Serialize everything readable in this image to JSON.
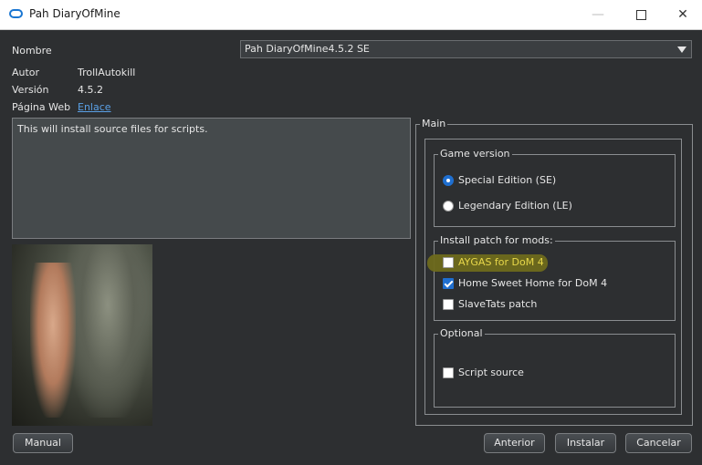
{
  "window": {
    "title": "Pah DiaryOfMine"
  },
  "fields": {
    "nombre_label": "Nombre",
    "autor_label": "Autor",
    "autor_value": "TrollAutokill",
    "version_label": "Versión",
    "version_value": "4.5.2",
    "web_label": "Página Web",
    "web_link": "Enlace"
  },
  "combo": {
    "selected": "Pah DiaryOfMine4.5.2 SE"
  },
  "description": "This will install source files for scripts.",
  "main": {
    "title": "Main",
    "game_version": {
      "title": "Game version",
      "options": [
        {
          "label": "Special Edition (SE)",
          "selected": true
        },
        {
          "label": "Legendary Edition (LE)",
          "selected": false
        }
      ]
    },
    "patches": {
      "title": "Install patch for mods:",
      "options": [
        {
          "label": "AYGAS for DoM 4",
          "checked": false
        },
        {
          "label": "Home Sweet Home for DoM 4",
          "checked": true
        },
        {
          "label": "SlaveTats patch",
          "checked": false
        }
      ]
    },
    "optional": {
      "title": "Optional",
      "options": [
        {
          "label": "Script source",
          "checked": false
        }
      ]
    }
  },
  "buttons": {
    "manual": "Manual",
    "back": "Anterior",
    "install": "Instalar",
    "cancel": "Cancelar"
  },
  "colors": {
    "accent": "#1f6fd0",
    "link": "#5aa0e6",
    "highlight": "#6e6a1c"
  }
}
